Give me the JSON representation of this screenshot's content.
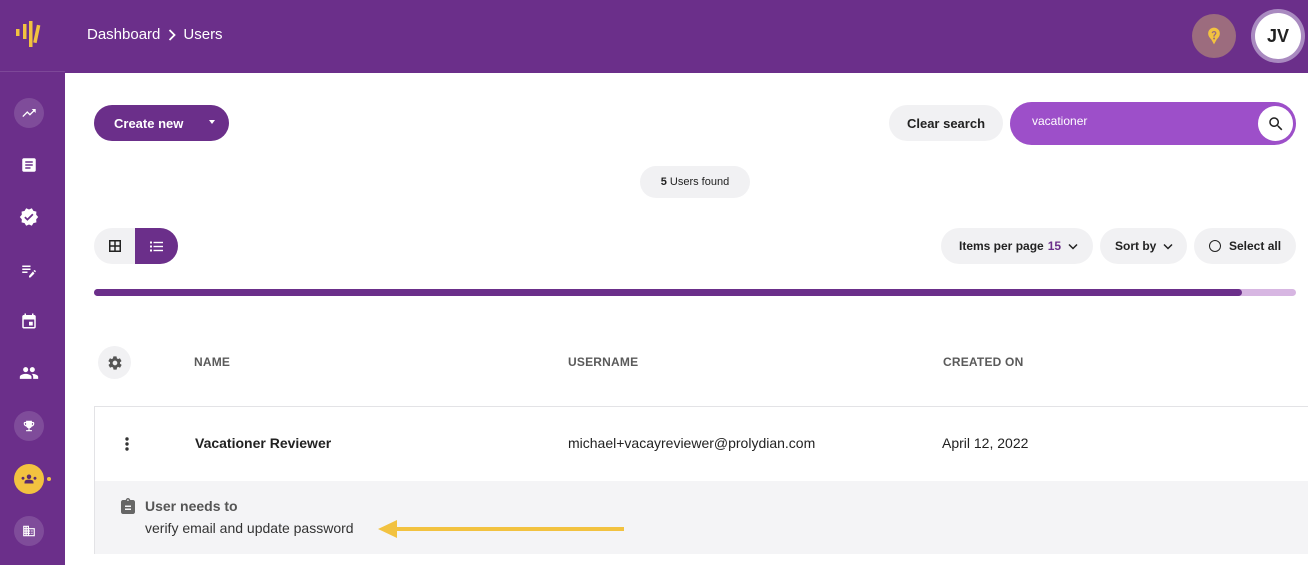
{
  "header": {
    "breadcrumbs": [
      "Dashboard",
      "Users"
    ],
    "avatar_initials": "JV"
  },
  "sidebar": {
    "items": [
      {
        "name": "trending-up-icon"
      },
      {
        "name": "article-icon"
      },
      {
        "name": "verified-icon"
      },
      {
        "name": "edit-note-icon"
      },
      {
        "name": "calendar-icon"
      },
      {
        "name": "people-icon"
      },
      {
        "name": "trophy-icon"
      },
      {
        "name": "groups-icon",
        "active": true
      },
      {
        "name": "domain-icon"
      }
    ]
  },
  "toolbar": {
    "create_label": "Create new",
    "clear_search_label": "Clear search",
    "search_value": "vacationer"
  },
  "results": {
    "count": "5",
    "label": "Users found"
  },
  "controls": {
    "items_per_page_label": "Items per page",
    "items_per_page_value": "15",
    "sort_label": "Sort by",
    "select_all_label": "Select all",
    "progress_fraction": 0.955
  },
  "table": {
    "columns": [
      "NAME",
      "USERNAME",
      "CREATED ON"
    ],
    "rows": [
      {
        "name": "Vacationer Reviewer",
        "username": "michael+vacayreviewer@prolydian.com",
        "created_on": "April 12, 2022",
        "note_title": "User needs to",
        "note_text": "verify email and update password"
      }
    ]
  },
  "colors": {
    "brand": "#6b2f8a",
    "search": "#9d4fc9",
    "accent": "#f2c240"
  }
}
